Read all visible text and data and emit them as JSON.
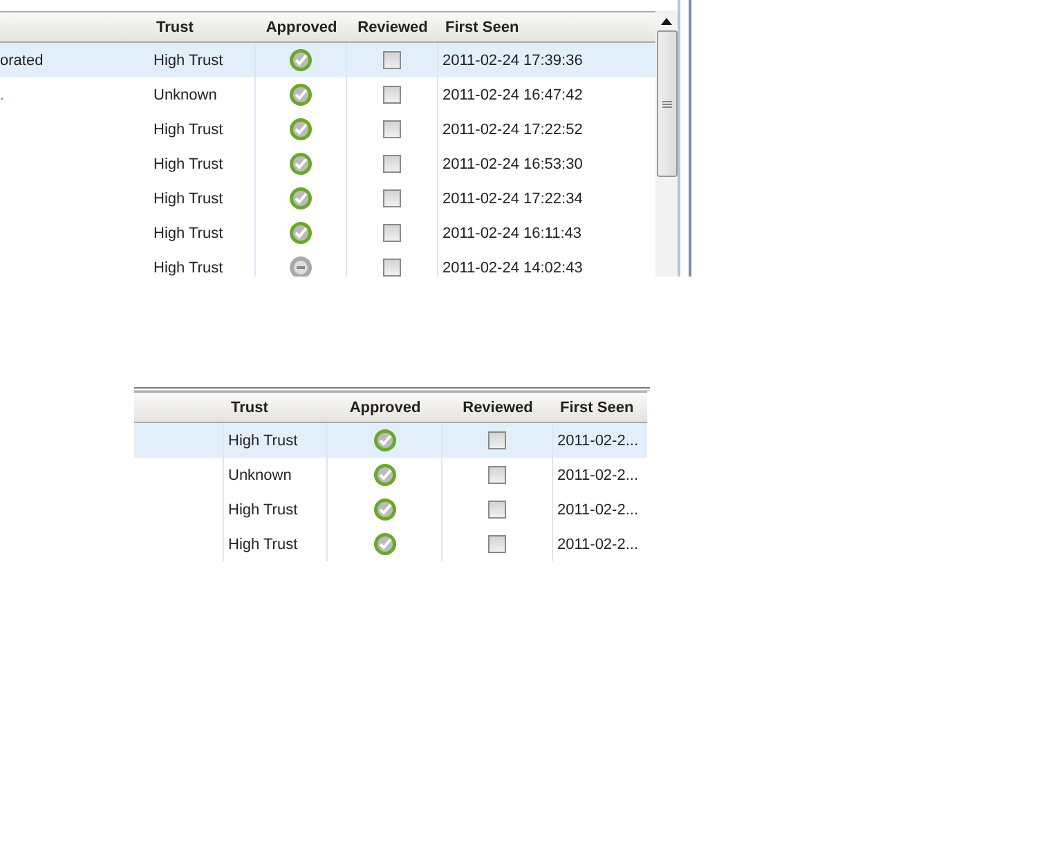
{
  "top_table": {
    "columns": [
      "Trust",
      "Approved",
      "Reviewed",
      "First Seen"
    ],
    "rows": [
      {
        "name": "orated",
        "trust": "High Trust",
        "approved": true,
        "reviewed": false,
        "first_seen": "2011-02-24 17:39:36",
        "selected": true
      },
      {
        "name": ".",
        "trust": "Unknown",
        "approved": true,
        "reviewed": false,
        "first_seen": "2011-02-24 16:47:42",
        "selected": false
      },
      {
        "trust": "High Trust",
        "approved": true,
        "reviewed": false,
        "first_seen": "2011-02-24 17:22:52",
        "selected": false
      },
      {
        "trust": "High Trust",
        "approved": true,
        "reviewed": false,
        "first_seen": "2011-02-24 16:53:30",
        "selected": false
      },
      {
        "trust": "High Trust",
        "approved": true,
        "reviewed": false,
        "first_seen": "2011-02-24 17:22:34",
        "selected": false
      },
      {
        "trust": "High Trust",
        "approved": true,
        "reviewed": false,
        "first_seen": "2011-02-24 16:11:43",
        "selected": false
      },
      {
        "trust": "High Trust",
        "approved": false,
        "reviewed": false,
        "first_seen": "2011-02-24 14:02:43",
        "selected": false
      }
    ]
  },
  "bottom_table": {
    "columns": [
      "Trust",
      "Approved",
      "Reviewed",
      "First Seen"
    ],
    "rows": [
      {
        "trust": "High Trust",
        "approved": true,
        "reviewed": false,
        "first_seen": "2011-02-2...",
        "selected": true
      },
      {
        "trust": "Unknown",
        "approved": true,
        "reviewed": false,
        "first_seen": "2011-02-2...",
        "selected": false
      },
      {
        "trust": "High Trust",
        "approved": true,
        "reviewed": false,
        "first_seen": "2011-02-2...",
        "selected": false
      },
      {
        "trust": "High Trust",
        "approved": true,
        "reviewed": false,
        "first_seen": "2011-02-2...",
        "selected": false
      }
    ]
  }
}
